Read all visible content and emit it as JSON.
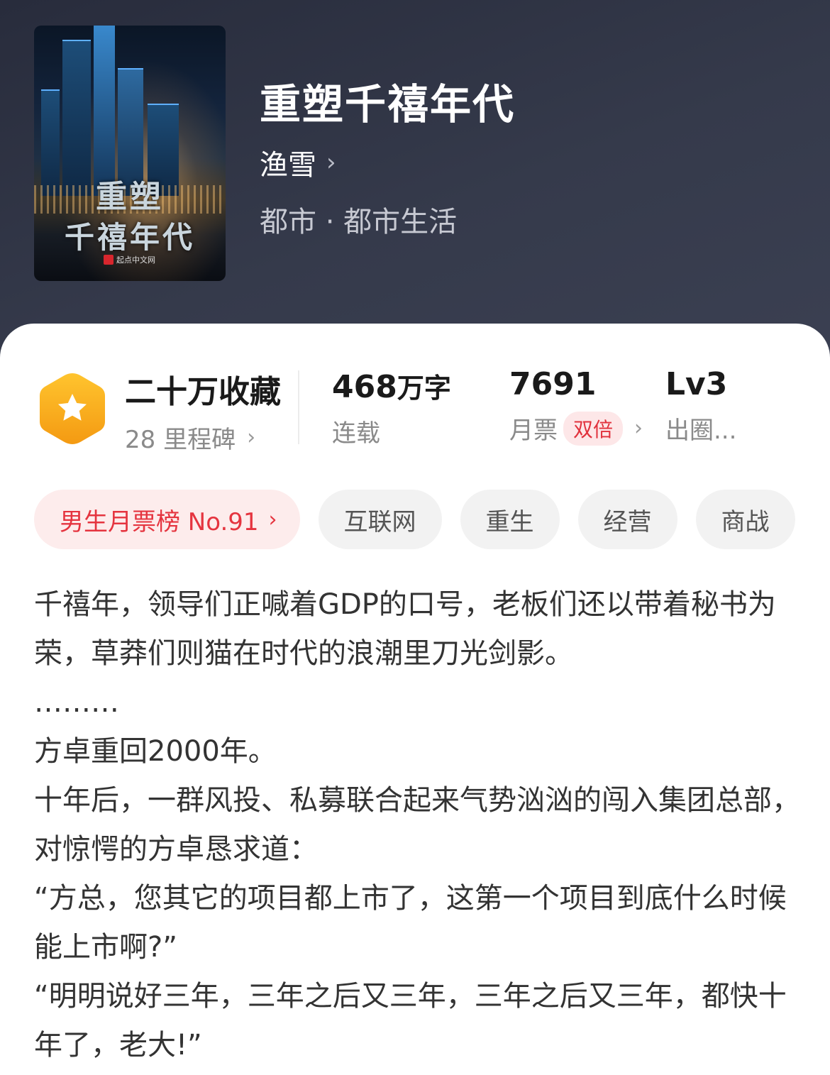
{
  "book": {
    "title": "重塑千禧年代",
    "author": "渔雪",
    "genre": "都市 · 都市生活",
    "cover": {
      "title_line1": "重塑",
      "title_line2": "千禧年代",
      "publisher": "起点中文网"
    }
  },
  "stats": {
    "collection": {
      "value": "二十万收藏",
      "sub": "28 里程碑"
    },
    "words": {
      "value": "468",
      "unit": "万字",
      "sub": "连载"
    },
    "monthly_ticket": {
      "value": "7691",
      "sub": "月票",
      "badge": "双倍"
    },
    "level": {
      "value": "Lv3",
      "sub": "出圈..."
    }
  },
  "tags": {
    "rank": "男生月票榜 No.91",
    "items": [
      "互联网",
      "重生",
      "经营",
      "商战"
    ]
  },
  "synopsis": [
    "千禧年，领导们正喊着GDP的口号，老板们还以带着秘书为荣，草莽们则猫在时代的浪潮里刀光剑影。",
    "………",
    "方卓重回2000年。",
    "十年后，一群风投、私募联合起来气势汹汹的闯入集团总部，对惊愕的方卓恳求道：",
    "“方总，您其它的项目都上市了，这第一个项目到底什么时候能上市啊?”",
    "“明明说好三年，三年之后又三年，三年之后又三年，都快十年了，老大!”"
  ],
  "colors": {
    "header_bg": "#2c3040",
    "accent_red": "#e5343f",
    "badge_orange": "#f7a81b"
  }
}
